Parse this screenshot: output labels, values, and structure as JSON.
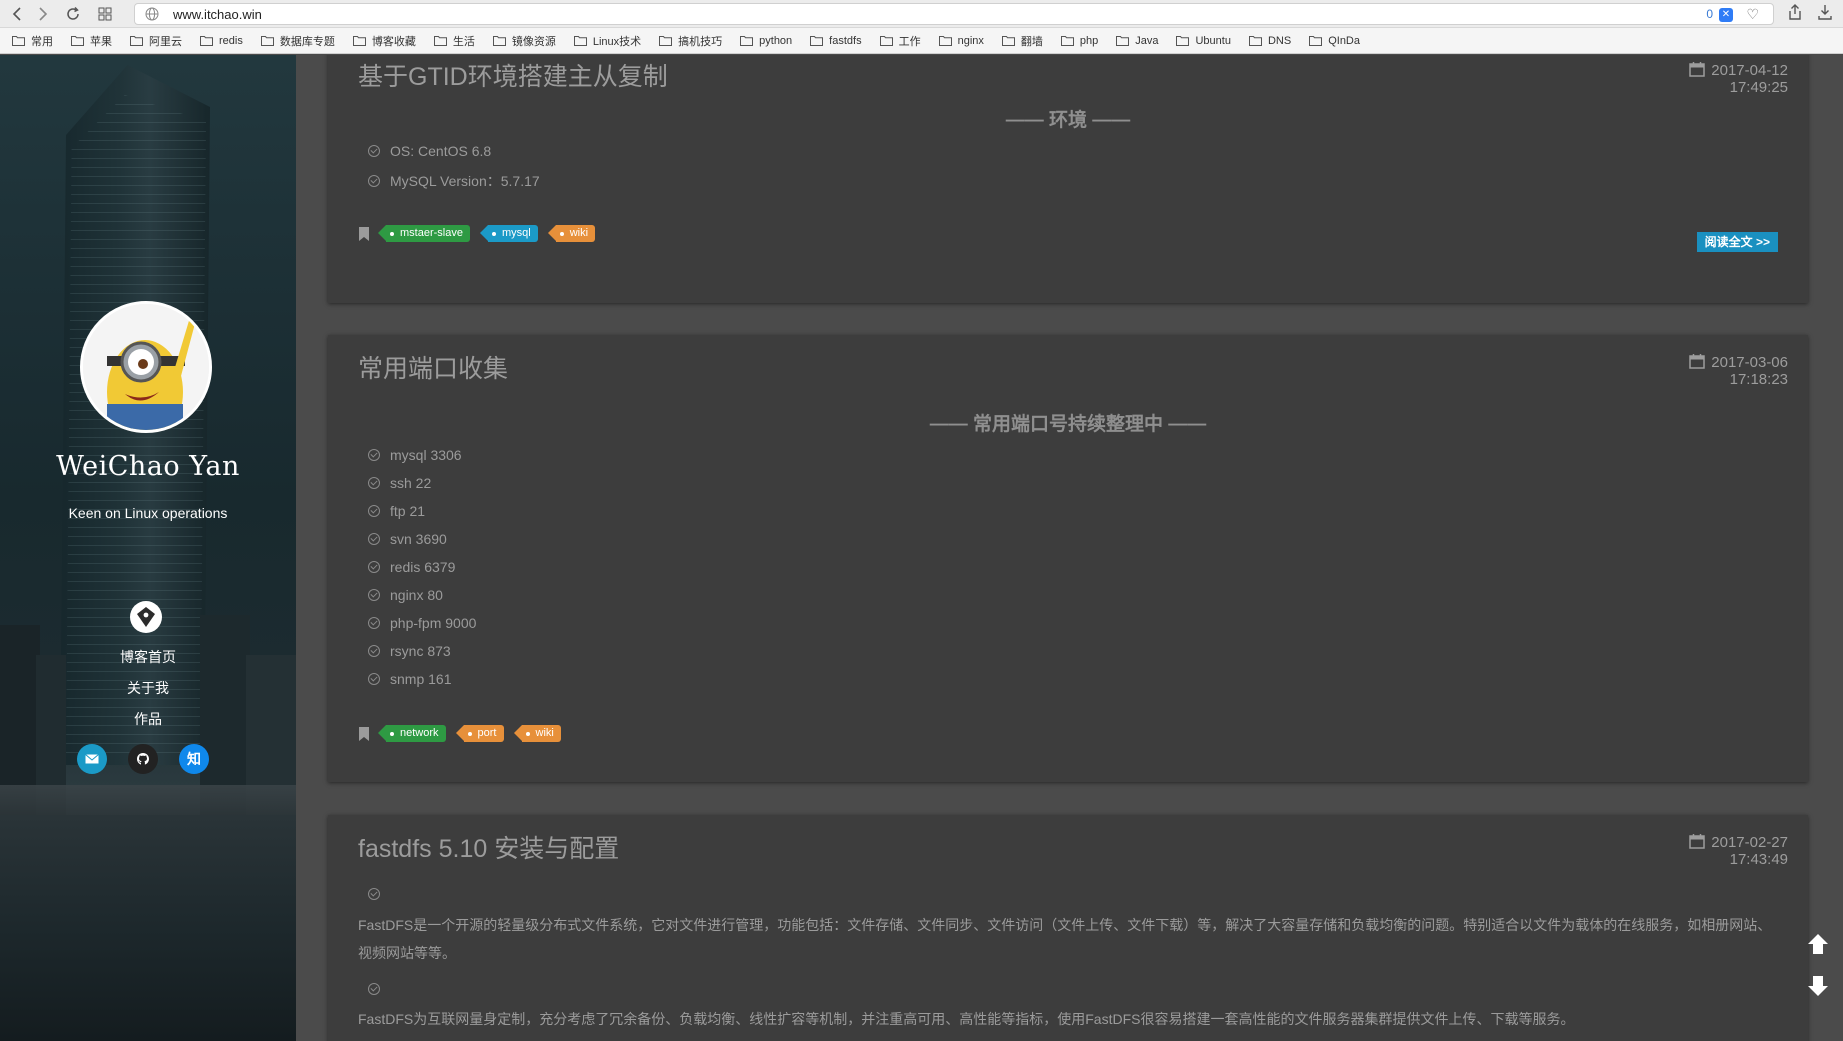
{
  "browser": {
    "url": "www.itchao.win",
    "ext_count": "0",
    "bookmarks": [
      "常用",
      "苹果",
      "阿里云",
      "redis",
      "数据库专题",
      "博客收藏",
      "生活",
      "镜像资源",
      "Linux技术",
      "搞机技巧",
      "python",
      "fastdfs",
      "工作",
      "nginx",
      "翻墙",
      "php",
      "Java",
      "Ubuntu",
      "DNS",
      "QInDa"
    ]
  },
  "sidebar": {
    "author": "WeiChao Yan",
    "description": "Keen on Linux operations",
    "nav": [
      "博客首页",
      "关于我",
      "作品"
    ],
    "social": [
      {
        "icon": "mail-icon",
        "color": "#1b9ac7"
      },
      {
        "icon": "github-icon",
        "color": "#222222"
      },
      {
        "icon": "zhihu-icon",
        "label": "知",
        "color": "#0f88eb"
      }
    ]
  },
  "posts": [
    {
      "title": "基于GTID环境搭建主从复制",
      "date": "2017-04-12",
      "time": "17:49:25",
      "subtitle": "—— 环境 ——",
      "items": [
        "OS: CentOS 6.8",
        "MySQL Version：5.7.17"
      ],
      "tags": [
        {
          "label": "mstaer-slave",
          "color": "green"
        },
        {
          "label": "mysql",
          "color": "blue"
        },
        {
          "label": "wiki",
          "color": "orange"
        }
      ],
      "read_more": "阅读全文 >>"
    },
    {
      "title": "常用端口收集",
      "date": "2017-03-06",
      "time": "17:18:23",
      "subtitle": "—— 常用端口号持续整理中 ——",
      "items": [
        "mysql 3306",
        "ssh 22",
        "ftp 21",
        "svn 3690",
        "redis 6379",
        "nginx 80",
        "php-fpm 9000",
        "rsync 873",
        "snmp 161"
      ],
      "tags": [
        {
          "label": "network",
          "color": "green"
        },
        {
          "label": "port",
          "color": "orange"
        },
        {
          "label": "wiki",
          "color": "orange"
        }
      ]
    },
    {
      "title": "fastdfs 5.10 安装与配置",
      "date": "2017-02-27",
      "time": "17:43:49",
      "paragraphs": [
        "FastDFS是一个开源的轻量级分布式文件系统，它对文件进行管理，功能包括：文件存储、文件同步、文件访问（文件上传、文件下载）等，解决了大容量存储和负载均衡的问题。特别适合以文件为载体的在线服务，如相册网站、视频网站等等。",
        "FastDFS为互联网量身定制，充分考虑了冗余备份、负载均衡、线性扩容等机制，并注重高可用、高性能等指标，使用FastDFS很容易搭建一套高性能的文件服务器集群提供文件上传、下载等服务。"
      ]
    }
  ]
}
